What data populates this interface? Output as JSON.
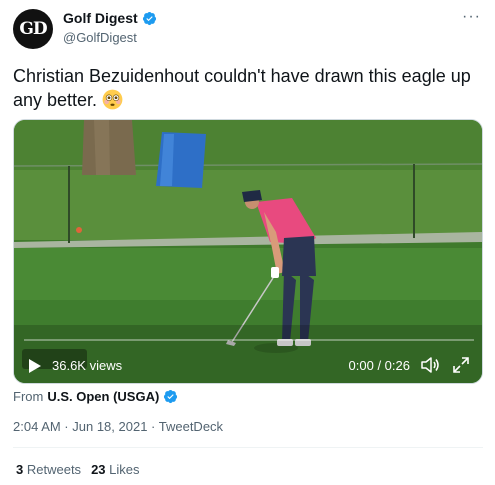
{
  "author": {
    "avatar_text": "GD",
    "display_name": "Golf Digest",
    "handle": "@GolfDigest",
    "verified_icon": "verified-badge-icon"
  },
  "tweet": {
    "text": "Christian Bezuidenhout couldn't have drawn this eagle up any better.",
    "emoji": "flushed-face-emoji"
  },
  "video": {
    "views": "36.6K views",
    "time": "0:00 / 0:26",
    "progress": 0
  },
  "source": {
    "prefix": "From",
    "name": "U.S. Open (USGA)"
  },
  "meta": {
    "timestamp": "2:04 AM · Jun 18, 2021 · TweetDeck"
  },
  "stats": {
    "retweets_count": "3",
    "retweets_label": "Retweets",
    "likes_count": "23",
    "likes_label": "Likes"
  },
  "colors": {
    "verified": "#1d9bf0",
    "text": "#0f1419",
    "secondary": "#536471",
    "shirt": "#e84a7f",
    "grass": "#4f8a38"
  }
}
